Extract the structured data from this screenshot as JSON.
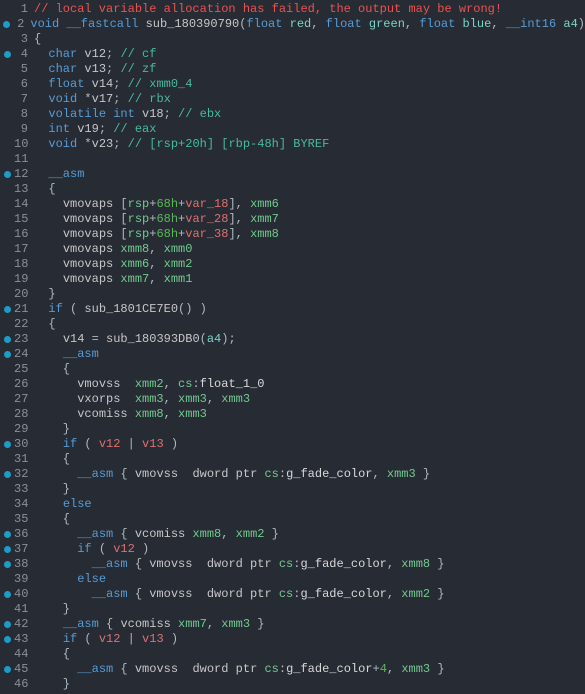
{
  "lines": [
    {
      "n": 1,
      "bp": false,
      "segs": [
        [
          "c-comment",
          "// local variable allocation has failed, the output may be wrong!"
        ]
      ]
    },
    {
      "n": 2,
      "bp": true,
      "segs": [
        [
          "c-kw",
          "void"
        ],
        [
          "c-punc",
          " "
        ],
        [
          "c-kw",
          "__fastcall"
        ],
        [
          "c-punc",
          " "
        ],
        [
          "c-func",
          "sub_180390790"
        ],
        [
          "c-punc",
          "("
        ],
        [
          "c-kw",
          "float"
        ],
        [
          "c-punc",
          " "
        ],
        [
          "c-param",
          "red"
        ],
        [
          "c-punc",
          ", "
        ],
        [
          "c-kw",
          "float"
        ],
        [
          "c-punc",
          " "
        ],
        [
          "c-param",
          "green"
        ],
        [
          "c-punc",
          ", "
        ],
        [
          "c-kw",
          "float"
        ],
        [
          "c-punc",
          " "
        ],
        [
          "c-param",
          "blue"
        ],
        [
          "c-punc",
          ", "
        ],
        [
          "c-kw",
          "__int16"
        ],
        [
          "c-punc",
          " "
        ],
        [
          "c-param",
          "a4"
        ],
        [
          "c-punc",
          ")"
        ]
      ]
    },
    {
      "n": 3,
      "bp": false,
      "segs": [
        [
          "c-punc",
          "{"
        ]
      ]
    },
    {
      "n": 4,
      "bp": true,
      "segs": [
        [
          "c-punc",
          "  "
        ],
        [
          "c-kw",
          "char"
        ],
        [
          "c-punc",
          " "
        ],
        [
          "c-var",
          "v12"
        ],
        [
          "c-punc",
          "; "
        ],
        [
          "c-str",
          "// cf"
        ]
      ]
    },
    {
      "n": 5,
      "bp": false,
      "segs": [
        [
          "c-punc",
          "  "
        ],
        [
          "c-kw",
          "char"
        ],
        [
          "c-punc",
          " "
        ],
        [
          "c-var",
          "v13"
        ],
        [
          "c-punc",
          "; "
        ],
        [
          "c-str",
          "// zf"
        ]
      ]
    },
    {
      "n": 6,
      "bp": false,
      "segs": [
        [
          "c-punc",
          "  "
        ],
        [
          "c-kw",
          "float"
        ],
        [
          "c-punc",
          " "
        ],
        [
          "c-var",
          "v14"
        ],
        [
          "c-punc",
          "; "
        ],
        [
          "c-str",
          "// xmm0_4"
        ]
      ]
    },
    {
      "n": 7,
      "bp": false,
      "segs": [
        [
          "c-punc",
          "  "
        ],
        [
          "c-kw",
          "void"
        ],
        [
          "c-punc",
          " *"
        ],
        [
          "c-var",
          "v17"
        ],
        [
          "c-punc",
          "; "
        ],
        [
          "c-str",
          "// rbx"
        ]
      ]
    },
    {
      "n": 8,
      "bp": false,
      "segs": [
        [
          "c-punc",
          "  "
        ],
        [
          "c-kw",
          "volatile int"
        ],
        [
          "c-punc",
          " "
        ],
        [
          "c-var",
          "v18"
        ],
        [
          "c-punc",
          "; "
        ],
        [
          "c-str",
          "// ebx"
        ]
      ]
    },
    {
      "n": 9,
      "bp": false,
      "segs": [
        [
          "c-punc",
          "  "
        ],
        [
          "c-kw",
          "int"
        ],
        [
          "c-punc",
          " "
        ],
        [
          "c-var",
          "v19"
        ],
        [
          "c-punc",
          "; "
        ],
        [
          "c-str",
          "// eax"
        ]
      ]
    },
    {
      "n": 10,
      "bp": false,
      "segs": [
        [
          "c-punc",
          "  "
        ],
        [
          "c-kw",
          "void"
        ],
        [
          "c-punc",
          " *"
        ],
        [
          "c-var",
          "v23"
        ],
        [
          "c-punc",
          "; "
        ],
        [
          "c-str",
          "// [rsp+20h] [rbp-48h] BYREF"
        ]
      ]
    },
    {
      "n": 11,
      "bp": false,
      "segs": []
    },
    {
      "n": 12,
      "bp": true,
      "segs": [
        [
          "c-punc",
          "  "
        ],
        [
          "c-kw",
          "__asm"
        ]
      ]
    },
    {
      "n": 13,
      "bp": false,
      "segs": [
        [
          "c-punc",
          "  {"
        ]
      ]
    },
    {
      "n": 14,
      "bp": false,
      "segs": [
        [
          "c-punc",
          "    "
        ],
        [
          "c-asm",
          "vmovaps "
        ],
        [
          "c-punc",
          "["
        ],
        [
          "c-reg",
          "rsp"
        ],
        [
          "c-punc",
          "+"
        ],
        [
          "c-green",
          "68h"
        ],
        [
          "c-punc",
          "+"
        ],
        [
          "c-bad",
          "var_18"
        ],
        [
          "c-punc",
          "], "
        ],
        [
          "c-reg",
          "xmm6"
        ]
      ]
    },
    {
      "n": 15,
      "bp": false,
      "segs": [
        [
          "c-punc",
          "    "
        ],
        [
          "c-asm",
          "vmovaps "
        ],
        [
          "c-punc",
          "["
        ],
        [
          "c-reg",
          "rsp"
        ],
        [
          "c-punc",
          "+"
        ],
        [
          "c-green",
          "68h"
        ],
        [
          "c-punc",
          "+"
        ],
        [
          "c-bad",
          "var_28"
        ],
        [
          "c-punc",
          "], "
        ],
        [
          "c-reg",
          "xmm7"
        ]
      ]
    },
    {
      "n": 16,
      "bp": false,
      "segs": [
        [
          "c-punc",
          "    "
        ],
        [
          "c-asm",
          "vmovaps "
        ],
        [
          "c-punc",
          "["
        ],
        [
          "c-reg",
          "rsp"
        ],
        [
          "c-punc",
          "+"
        ],
        [
          "c-green",
          "68h"
        ],
        [
          "c-punc",
          "+"
        ],
        [
          "c-bad",
          "var_38"
        ],
        [
          "c-punc",
          "], "
        ],
        [
          "c-reg",
          "xmm8"
        ]
      ]
    },
    {
      "n": 17,
      "bp": false,
      "segs": [
        [
          "c-punc",
          "    "
        ],
        [
          "c-asm",
          "vmovaps "
        ],
        [
          "c-reg",
          "xmm8"
        ],
        [
          "c-punc",
          ", "
        ],
        [
          "c-reg",
          "xmm0"
        ]
      ]
    },
    {
      "n": 18,
      "bp": false,
      "segs": [
        [
          "c-punc",
          "    "
        ],
        [
          "c-asm",
          "vmovaps "
        ],
        [
          "c-reg",
          "xmm6"
        ],
        [
          "c-punc",
          ", "
        ],
        [
          "c-reg",
          "xmm2"
        ]
      ]
    },
    {
      "n": 19,
      "bp": false,
      "segs": [
        [
          "c-punc",
          "    "
        ],
        [
          "c-asm",
          "vmovaps "
        ],
        [
          "c-reg",
          "xmm7"
        ],
        [
          "c-punc",
          ", "
        ],
        [
          "c-reg",
          "xmm1"
        ]
      ]
    },
    {
      "n": 20,
      "bp": false,
      "segs": [
        [
          "c-punc",
          "  }"
        ]
      ]
    },
    {
      "n": 21,
      "bp": true,
      "segs": [
        [
          "c-punc",
          "  "
        ],
        [
          "c-kw",
          "if"
        ],
        [
          "c-punc",
          " ( "
        ],
        [
          "c-func",
          "sub_1801CE7E0"
        ],
        [
          "c-punc",
          "() )"
        ]
      ]
    },
    {
      "n": 22,
      "bp": false,
      "segs": [
        [
          "c-punc",
          "  {"
        ]
      ]
    },
    {
      "n": 23,
      "bp": true,
      "segs": [
        [
          "c-punc",
          "    "
        ],
        [
          "c-var",
          "v14"
        ],
        [
          "c-punc",
          " = "
        ],
        [
          "c-func",
          "sub_180393DB0"
        ],
        [
          "c-punc",
          "("
        ],
        [
          "c-param",
          "a4"
        ],
        [
          "c-punc",
          ");"
        ]
      ]
    },
    {
      "n": 24,
      "bp": true,
      "segs": [
        [
          "c-punc",
          "    "
        ],
        [
          "c-kw",
          "__asm"
        ]
      ]
    },
    {
      "n": 25,
      "bp": false,
      "segs": [
        [
          "c-punc",
          "    {"
        ]
      ]
    },
    {
      "n": 26,
      "bp": false,
      "segs": [
        [
          "c-punc",
          "      "
        ],
        [
          "c-asm",
          "vmovss  "
        ],
        [
          "c-reg",
          "xmm2"
        ],
        [
          "c-punc",
          ", "
        ],
        [
          "c-reg",
          "cs"
        ],
        [
          "c-punc",
          ":"
        ],
        [
          "c-global",
          "float_1_0"
        ]
      ]
    },
    {
      "n": 27,
      "bp": false,
      "segs": [
        [
          "c-punc",
          "      "
        ],
        [
          "c-asm",
          "vxorps  "
        ],
        [
          "c-reg",
          "xmm3"
        ],
        [
          "c-punc",
          ", "
        ],
        [
          "c-reg",
          "xmm3"
        ],
        [
          "c-punc",
          ", "
        ],
        [
          "c-reg",
          "xmm3"
        ]
      ]
    },
    {
      "n": 28,
      "bp": false,
      "segs": [
        [
          "c-punc",
          "      "
        ],
        [
          "c-asm",
          "vcomiss "
        ],
        [
          "c-reg",
          "xmm8"
        ],
        [
          "c-punc",
          ", "
        ],
        [
          "c-reg",
          "xmm3"
        ]
      ]
    },
    {
      "n": 29,
      "bp": false,
      "segs": [
        [
          "c-punc",
          "    }"
        ]
      ]
    },
    {
      "n": 30,
      "bp": true,
      "segs": [
        [
          "c-punc",
          "    "
        ],
        [
          "c-kw",
          "if"
        ],
        [
          "c-punc",
          " ( "
        ],
        [
          "c-bad",
          "v12"
        ],
        [
          "c-punc",
          " | "
        ],
        [
          "c-bad",
          "v13"
        ],
        [
          "c-punc",
          " )"
        ]
      ]
    },
    {
      "n": 31,
      "bp": false,
      "segs": [
        [
          "c-punc",
          "    {"
        ]
      ]
    },
    {
      "n": 32,
      "bp": true,
      "segs": [
        [
          "c-punc",
          "      "
        ],
        [
          "c-kw",
          "__asm"
        ],
        [
          "c-punc",
          " { "
        ],
        [
          "c-asm",
          "vmovss  dword ptr "
        ],
        [
          "c-reg",
          "cs"
        ],
        [
          "c-punc",
          ":"
        ],
        [
          "c-global",
          "g_fade_color"
        ],
        [
          "c-punc",
          ", "
        ],
        [
          "c-reg",
          "xmm3"
        ],
        [
          "c-punc",
          " }"
        ]
      ]
    },
    {
      "n": 33,
      "bp": false,
      "segs": [
        [
          "c-punc",
          "    }"
        ]
      ]
    },
    {
      "n": 34,
      "bp": false,
      "segs": [
        [
          "c-punc",
          "    "
        ],
        [
          "c-kw",
          "else"
        ]
      ]
    },
    {
      "n": 35,
      "bp": false,
      "segs": [
        [
          "c-punc",
          "    {"
        ]
      ]
    },
    {
      "n": 36,
      "bp": true,
      "segs": [
        [
          "c-punc",
          "      "
        ],
        [
          "c-kw",
          "__asm"
        ],
        [
          "c-punc",
          " { "
        ],
        [
          "c-asm",
          "vcomiss "
        ],
        [
          "c-reg",
          "xmm8"
        ],
        [
          "c-punc",
          ", "
        ],
        [
          "c-reg",
          "xmm2"
        ],
        [
          "c-punc",
          " }"
        ]
      ]
    },
    {
      "n": 37,
      "bp": true,
      "segs": [
        [
          "c-punc",
          "      "
        ],
        [
          "c-kw",
          "if"
        ],
        [
          "c-punc",
          " ( "
        ],
        [
          "c-bad",
          "v12"
        ],
        [
          "c-punc",
          " )"
        ]
      ]
    },
    {
      "n": 38,
      "bp": true,
      "segs": [
        [
          "c-punc",
          "        "
        ],
        [
          "c-kw",
          "__asm"
        ],
        [
          "c-punc",
          " { "
        ],
        [
          "c-asm",
          "vmovss  dword ptr "
        ],
        [
          "c-reg",
          "cs"
        ],
        [
          "c-punc",
          ":"
        ],
        [
          "c-global",
          "g_fade_color"
        ],
        [
          "c-punc",
          ", "
        ],
        [
          "c-reg",
          "xmm8"
        ],
        [
          "c-punc",
          " }"
        ]
      ]
    },
    {
      "n": 39,
      "bp": false,
      "segs": [
        [
          "c-punc",
          "      "
        ],
        [
          "c-kw",
          "else"
        ]
      ]
    },
    {
      "n": 40,
      "bp": true,
      "segs": [
        [
          "c-punc",
          "        "
        ],
        [
          "c-kw",
          "__asm"
        ],
        [
          "c-punc",
          " { "
        ],
        [
          "c-asm",
          "vmovss  dword ptr "
        ],
        [
          "c-reg",
          "cs"
        ],
        [
          "c-punc",
          ":"
        ],
        [
          "c-global",
          "g_fade_color"
        ],
        [
          "c-punc",
          ", "
        ],
        [
          "c-reg",
          "xmm2"
        ],
        [
          "c-punc",
          " }"
        ]
      ]
    },
    {
      "n": 41,
      "bp": false,
      "segs": [
        [
          "c-punc",
          "    }"
        ]
      ]
    },
    {
      "n": 42,
      "bp": true,
      "segs": [
        [
          "c-punc",
          "    "
        ],
        [
          "c-kw",
          "__asm"
        ],
        [
          "c-punc",
          " { "
        ],
        [
          "c-asm",
          "vcomiss "
        ],
        [
          "c-reg",
          "xmm7"
        ],
        [
          "c-punc",
          ", "
        ],
        [
          "c-reg",
          "xmm3"
        ],
        [
          "c-punc",
          " }"
        ]
      ]
    },
    {
      "n": 43,
      "bp": true,
      "segs": [
        [
          "c-punc",
          "    "
        ],
        [
          "c-kw",
          "if"
        ],
        [
          "c-punc",
          " ( "
        ],
        [
          "c-bad",
          "v12"
        ],
        [
          "c-punc",
          " | "
        ],
        [
          "c-bad",
          "v13"
        ],
        [
          "c-punc",
          " )"
        ]
      ]
    },
    {
      "n": 44,
      "bp": false,
      "segs": [
        [
          "c-punc",
          "    {"
        ]
      ]
    },
    {
      "n": 45,
      "bp": true,
      "segs": [
        [
          "c-punc",
          "      "
        ],
        [
          "c-kw",
          "__asm"
        ],
        [
          "c-punc",
          " { "
        ],
        [
          "c-asm",
          "vmovss  dword ptr "
        ],
        [
          "c-reg",
          "cs"
        ],
        [
          "c-punc",
          ":"
        ],
        [
          "c-global",
          "g_fade_color"
        ],
        [
          "c-punc",
          "+"
        ],
        [
          "c-green",
          "4"
        ],
        [
          "c-punc",
          ", "
        ],
        [
          "c-reg",
          "xmm3"
        ],
        [
          "c-punc",
          " }"
        ]
      ]
    },
    {
      "n": 46,
      "bp": false,
      "segs": [
        [
          "c-punc",
          "    }"
        ]
      ]
    }
  ]
}
